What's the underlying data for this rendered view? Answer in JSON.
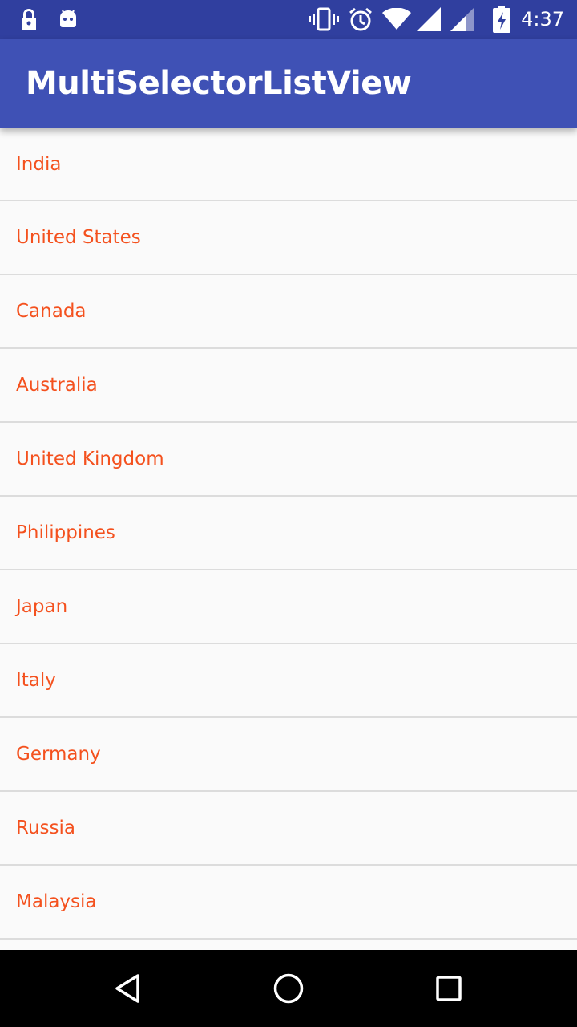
{
  "status_bar": {
    "time": "4:37",
    "left_icons": [
      "lock-icon",
      "android-icon"
    ],
    "right_icons": [
      "vibrate-icon",
      "alarm-icon",
      "wifi-icon",
      "signal-icon",
      "signal-icon",
      "battery-charging-icon"
    ]
  },
  "app_bar": {
    "title": "MultiSelectorListView",
    "color": "#3f51b5"
  },
  "list": {
    "text_color": "#f4511e",
    "items": [
      {
        "label": "India"
      },
      {
        "label": "United States"
      },
      {
        "label": "Canada"
      },
      {
        "label": "Australia"
      },
      {
        "label": "United Kingdom"
      },
      {
        "label": "Philippines"
      },
      {
        "label": "Japan"
      },
      {
        "label": "Italy"
      },
      {
        "label": "Germany"
      },
      {
        "label": "Russia"
      },
      {
        "label": "Malaysia"
      }
    ]
  },
  "nav_bar": {
    "buttons": [
      "back-icon",
      "home-icon",
      "recents-icon"
    ]
  }
}
